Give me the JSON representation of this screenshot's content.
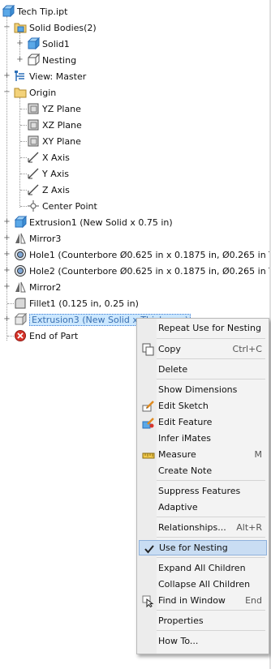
{
  "tree": {
    "root": "Tech Tip.ipt",
    "solid_bodies": "Solid Bodies(2)",
    "solid1": "Solid1",
    "nesting": "Nesting",
    "view": "View: Master",
    "origin": "Origin",
    "yz": "YZ Plane",
    "xz": "XZ Plane",
    "xy": "XY Plane",
    "xaxis": "X Axis",
    "yaxis": "Y Axis",
    "zaxis": "Z Axis",
    "center": "Center Point",
    "extrusion1": "Extrusion1 (New Solid x 0.75 in)",
    "mirror3": "Mirror3",
    "hole1": "Hole1 (Counterbore Ø0.625 in x 0.1875 in, Ø0.265 in T",
    "hole2": "Hole2 (Counterbore Ø0.625 in x 0.1875 in, Ø0.265 in T",
    "mirror2": "Mirror2",
    "fillet1": "Fillet1 (0.125 in, 0.25 in)",
    "extrusion3": "Extrusion3 (New Solid x Thickness)",
    "end": "End of Part"
  },
  "menu": {
    "repeat": "Repeat Use for Nesting",
    "copy": "Copy",
    "copy_sc": "Ctrl+C",
    "delete": "Delete",
    "show_dims": "Show Dimensions",
    "edit_sketch": "Edit Sketch",
    "edit_feature": "Edit Feature",
    "infer": "Infer iMates",
    "measure": "Measure",
    "measure_sc": "M",
    "create_note": "Create Note",
    "suppress": "Suppress Features",
    "adaptive": "Adaptive",
    "relationships": "Relationships...",
    "relationships_sc": "Alt+R",
    "use_nesting": "Use for Nesting",
    "expand": "Expand All Children",
    "collapse": "Collapse All Children",
    "find": "Find in Window",
    "find_sc": "End",
    "properties": "Properties",
    "howto": "How To..."
  }
}
